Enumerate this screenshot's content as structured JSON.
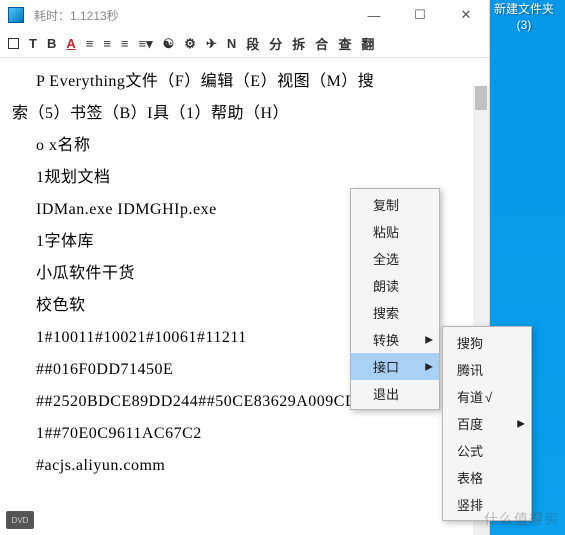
{
  "title": "耗时：1.1213秒",
  "toolbar": {
    "tb_t": "T",
    "tb_b": "B",
    "tb_a": "A",
    "tb_n": "N",
    "tb_seg": "段",
    "tb_sep": "分",
    "tb_split": "拆",
    "tb_join": "合",
    "tb_find": "查",
    "tb_tran": "翻"
  },
  "body": {
    "l1a": "P   Everything文件（F）编辑（E）视图（M）搜",
    "l1b": "索（5）书签（B）I具（1）帮助（H）",
    "l2": "o x名称",
    "l3": "1规划文档",
    "l4": "IDMan.exe IDMGHIp.exe",
    "l5": "1字体库",
    "l6": "小瓜软件干货",
    "l7": "校色软",
    "l8": "1#10011#10021#10061#11211",
    "l9": "##016F0DD71450E",
    "l10": "##2520BDCE89DD244##50CE83629A009CD",
    "l11": "1##70E0C9611AC67C2",
    "l12": "#acjs.aliyun.comm"
  },
  "menu1": {
    "copy": "复制",
    "paste": "粘贴",
    "selall": "全选",
    "read": "朗读",
    "search": "搜索",
    "convert": "转换",
    "api": "接口",
    "exit": "退出"
  },
  "menu2": {
    "sogou": "搜狗",
    "tencent": "腾讯",
    "youdao": "有道",
    "youdao_check": "√",
    "baidu": "百度",
    "formula": "公式",
    "table": "表格",
    "vertical": "竖排"
  },
  "desktop": {
    "folder_name_1": "新建文件夹",
    "folder_name_2": "(3)"
  },
  "watermark": "什么值得买",
  "dvd": "DVD"
}
